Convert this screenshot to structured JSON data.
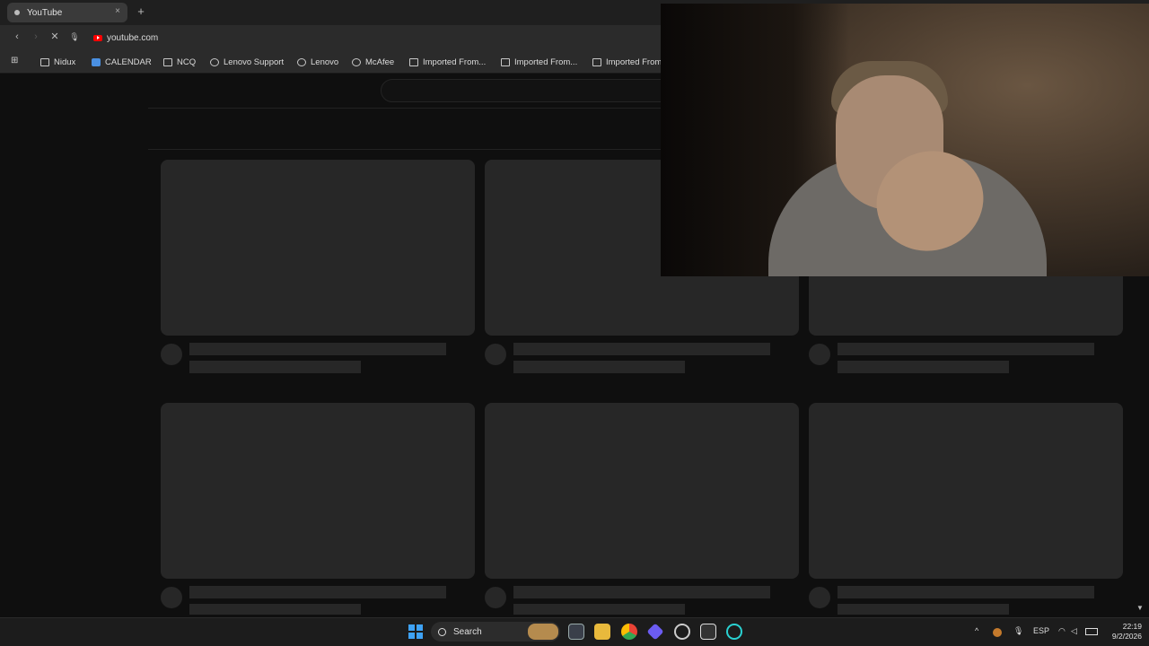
{
  "browser": {
    "tab": {
      "title": "YouTube",
      "close": "×"
    },
    "new_tab": "+",
    "nav": {
      "back": "‹",
      "forward": "›",
      "reload": "✕",
      "mic": "🎙"
    },
    "url": "youtube.com",
    "apps_icon": "⊞",
    "bookmarks": [
      {
        "label": "Nidux",
        "icon": "folder-icon"
      },
      {
        "label": "CALENDAR",
        "icon": "calendar-icon"
      },
      {
        "label": "NCQ",
        "icon": "folder-icon"
      },
      {
        "label": "Lenovo Support",
        "icon": "globe-icon"
      },
      {
        "label": "Lenovo",
        "icon": "globe-icon"
      },
      {
        "label": "McAfee",
        "icon": "globe-icon"
      },
      {
        "label": "Imported From...",
        "icon": "folder-icon"
      },
      {
        "label": "Imported From...",
        "icon": "folder-icon"
      },
      {
        "label": "Imported From",
        "icon": "folder-icon"
      }
    ]
  },
  "page": {
    "state": "loading-skeleton",
    "skeleton_cards": 9
  },
  "taskbar": {
    "search_label": "Search",
    "tray": {
      "language": "ESP",
      "chevron": "^"
    },
    "clock": {
      "time": "22:19",
      "date": "9/2/2026"
    }
  },
  "colors": {
    "page_bg": "#0f0f0f",
    "skeleton": "#272727",
    "chrome_bg": "#2b2b2b",
    "taskbar_bg": "#1c1c1c",
    "accent": "#3ea2f5"
  }
}
